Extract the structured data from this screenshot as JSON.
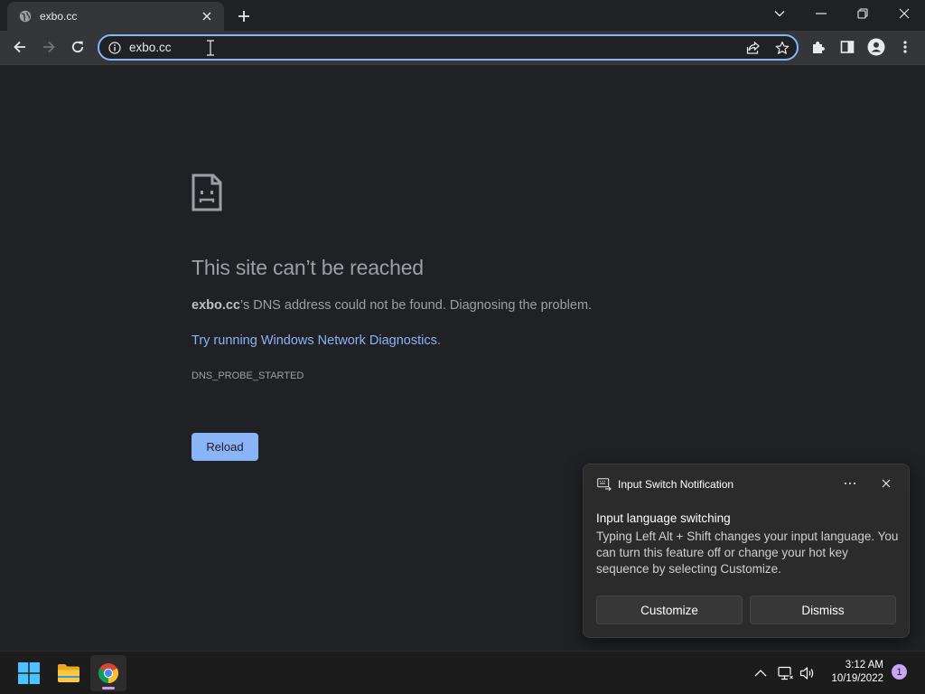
{
  "browser": {
    "tab": {
      "title": "exbo.cc"
    },
    "address_bar": {
      "value": "exbo.cc"
    }
  },
  "error_page": {
    "title": "This site can’t be reached",
    "domain": "exbo.cc",
    "description_suffix": "’s DNS address could not be found. Diagnosing the problem.",
    "diagnostics_link": "Try running Windows Network Diagnostics",
    "diagnostics_period": ".",
    "error_code": "DNS_PROBE_STARTED",
    "reload_label": "Reload"
  },
  "notification": {
    "app_name": "Input Switch Notification",
    "title": "Input language switching",
    "body": "Typing Left Alt + Shift changes your input language. You can turn this feature off or change your hot key sequence by selecting Customize.",
    "customize_label": "Customize",
    "dismiss_label": "Dismiss"
  },
  "taskbar": {
    "time": "3:12 AM",
    "date": "10/19/2022",
    "notification_count": "1"
  },
  "colors": {
    "accent": "#8ab4f8",
    "background": "#202124",
    "toolbar": "#35363a"
  }
}
